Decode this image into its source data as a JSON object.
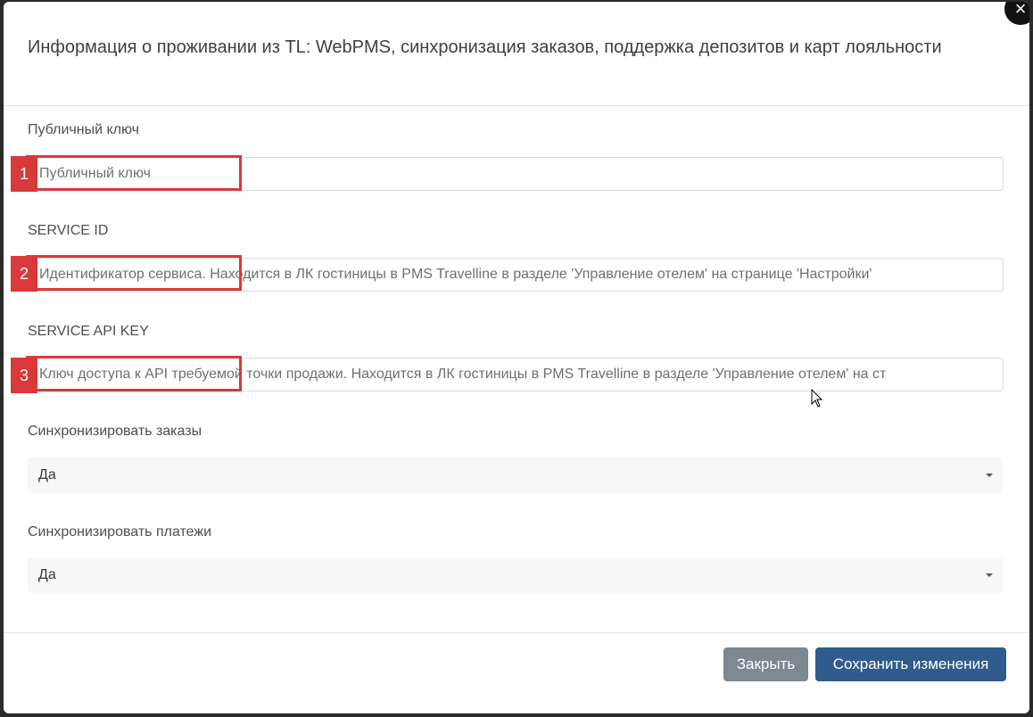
{
  "modal": {
    "title": "Информация о проживании из TL: WebPMS, синхронизация заказов, поддержка депозитов и карт лояльности",
    "close_icon": "×"
  },
  "fields": {
    "public_key": {
      "label": "Публичный ключ",
      "placeholder": "Публичный ключ",
      "annotation": "1"
    },
    "service_id": {
      "label": "SERVICE ID",
      "placeholder": "Идентификатор сервиса. Находится в ЛК гостиницы в PMS Travelline в разделе 'Управление отелем' на странице 'Настройки'",
      "annotation": "2"
    },
    "service_api_key": {
      "label": "SERVICE API KEY",
      "placeholder": "Ключ доступа к API требуемой точки продажи. Находится в ЛК гостиницы в PMS Travelline в разделе 'Управление отелем' на ст",
      "annotation": "3"
    },
    "sync_orders": {
      "label": "Синхронизировать заказы",
      "value": "Да"
    },
    "sync_payments": {
      "label": "Синхронизировать платежи",
      "value": "Да"
    }
  },
  "footer": {
    "close_label": "Закрыть",
    "save_label": "Сохранить изменения"
  },
  "colors": {
    "annotation": "#d9393a",
    "primary": "#2f5c8c",
    "secondary": "#7d8891"
  }
}
